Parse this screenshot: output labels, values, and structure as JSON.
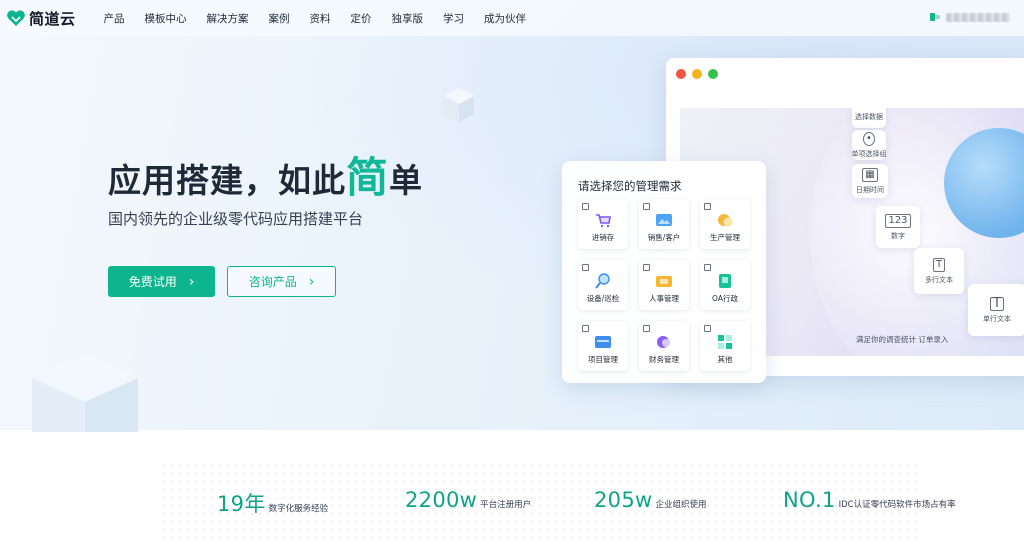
{
  "nav": {
    "logo_text": "简道云",
    "items": [
      "产品",
      "模板中心",
      "解决方案",
      "案例",
      "资料",
      "定价",
      "独享版",
      "学习",
      "成为伙伴"
    ]
  },
  "hero": {
    "headline_prefix": "应用搭建，如此",
    "headline_accent": "简",
    "headline_suffix": "单",
    "subhead": "国内领先的企业级零代码应用搭建平台",
    "primary_button": "免费试用",
    "secondary_button": "咨询产品"
  },
  "card": {
    "title": "请选择您的管理需求",
    "tiles": [
      {
        "label": "进销存",
        "icon": "cart-icon"
      },
      {
        "label": "销售/客户",
        "icon": "image-icon"
      },
      {
        "label": "生产管理",
        "icon": "gear-icon"
      },
      {
        "label": "设备/巡检",
        "icon": "magnifier-icon"
      },
      {
        "label": "人事管理",
        "icon": "folder-icon"
      },
      {
        "label": "OA行政",
        "icon": "oa-icon"
      },
      {
        "label": "项目管理",
        "icon": "project-icon"
      },
      {
        "label": "财务管理",
        "icon": "finance-icon"
      },
      {
        "label": "其他",
        "icon": "grid-icon"
      }
    ]
  },
  "mockup": {
    "widgets": [
      "选择数据",
      "单项选择组",
      "日期时间",
      "数字",
      "多行文本",
      "单行文本"
    ],
    "caption": "满足你的调查统计  订单录入"
  },
  "stats": [
    {
      "number": "19年",
      "desc": "数字化服务经验"
    },
    {
      "number": "2200w",
      "desc": "平台注册用户"
    },
    {
      "number": "205w",
      "desc": "企业组织使用"
    },
    {
      "number": "NO.1",
      "desc": "IDC认证零代码软件市场占有率"
    }
  ],
  "colors": {
    "brand": "#0db58f",
    "dot_red": "#f0563f",
    "dot_yellow": "#f5b41f",
    "dot_green": "#34c24b"
  }
}
